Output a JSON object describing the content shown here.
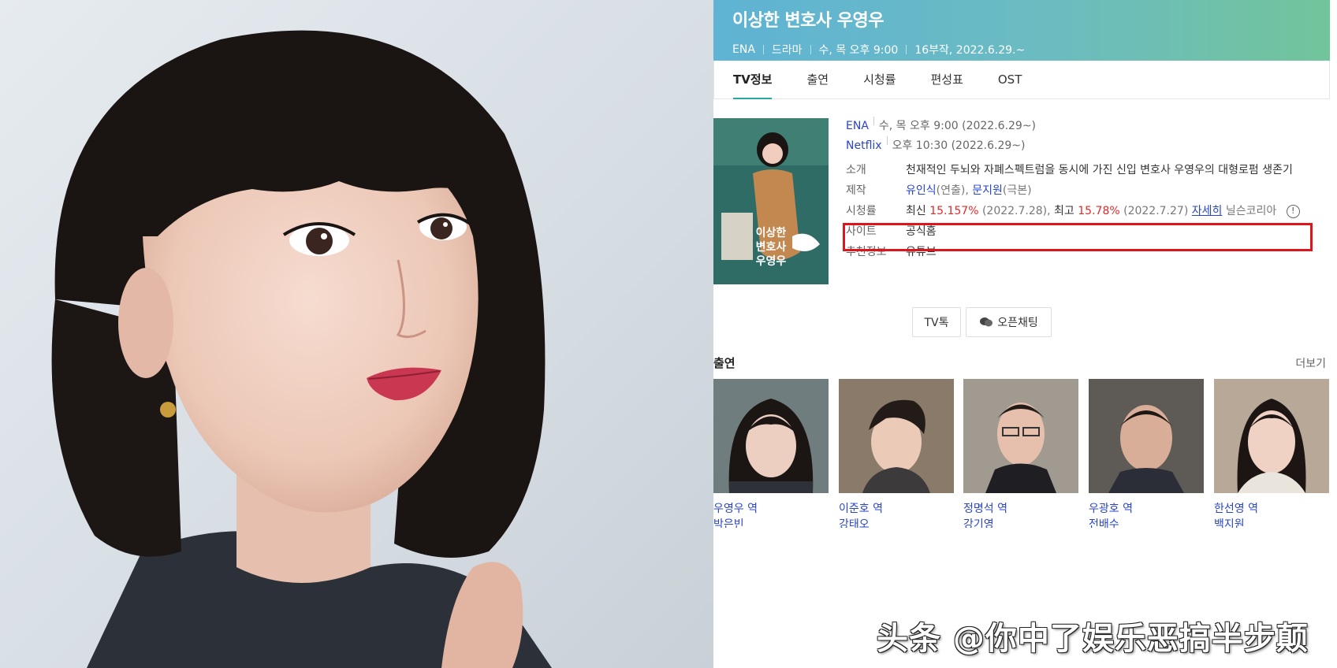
{
  "header": {
    "title": "이상한 변호사 우영우",
    "meta": [
      "ENA",
      "드라마",
      "수, 목 오후 9:00",
      "16부작, 2022.6.29.~"
    ]
  },
  "tabs": [
    {
      "label": "TV정보",
      "active": true
    },
    {
      "label": "출연"
    },
    {
      "label": "시청률"
    },
    {
      "label": "편성표"
    },
    {
      "label": "OST"
    }
  ],
  "poster": {
    "text_lines": [
      "이상한",
      "변호사",
      "우영우"
    ]
  },
  "broadcast": [
    {
      "channel": "ENA",
      "time": "수, 목 오후 9:00 (2022.6.29~)"
    },
    {
      "channel": "Netflix",
      "time": "오후 10:30 (2022.6.29~)"
    }
  ],
  "rows": {
    "intro_label": "소개",
    "intro_text": "천재적인 두뇌와 자폐스펙트럼을 동시에 가진 신입 변호사 우영우의 대형로펌 생존기",
    "production_label": "제작",
    "director": "유인식",
    "director_role": "(연출),",
    "writer": "문지원",
    "writer_role": "(극본)",
    "rating_label": "시청률",
    "latest_label": "최신",
    "latest_value": "15.157%",
    "latest_date": "(2022.7.28),",
    "max_label": "최고",
    "max_value": "15.78%",
    "max_date": "(2022.7.27)",
    "detail_link": "자세히",
    "source": "닐슨코리아",
    "site_label": "사이트",
    "site_value": "공식홈",
    "recommend_label": "추천정보",
    "recommend_value": "유튜브"
  },
  "buttons": {
    "tvtalk": "TV톡",
    "openchat": "오픈채팅"
  },
  "cast": {
    "title": "출연",
    "more": "더보기",
    "members": [
      {
        "role": "우영우 역",
        "actor": "박은빈"
      },
      {
        "role": "이준호 역",
        "actor": "강태오"
      },
      {
        "role": "정명석 역",
        "actor": "강기영"
      },
      {
        "role": "우광호 역",
        "actor": "전배수"
      },
      {
        "role": "한선영 역",
        "actor": "백지원"
      }
    ]
  },
  "watermark": "头条 @你中了娱乐恶搞半步颠",
  "colors": {
    "accent": "#2aa5a0",
    "link": "#2a44c9",
    "rating_red": "#e02a2a",
    "highlight_box": "#e0141b"
  }
}
